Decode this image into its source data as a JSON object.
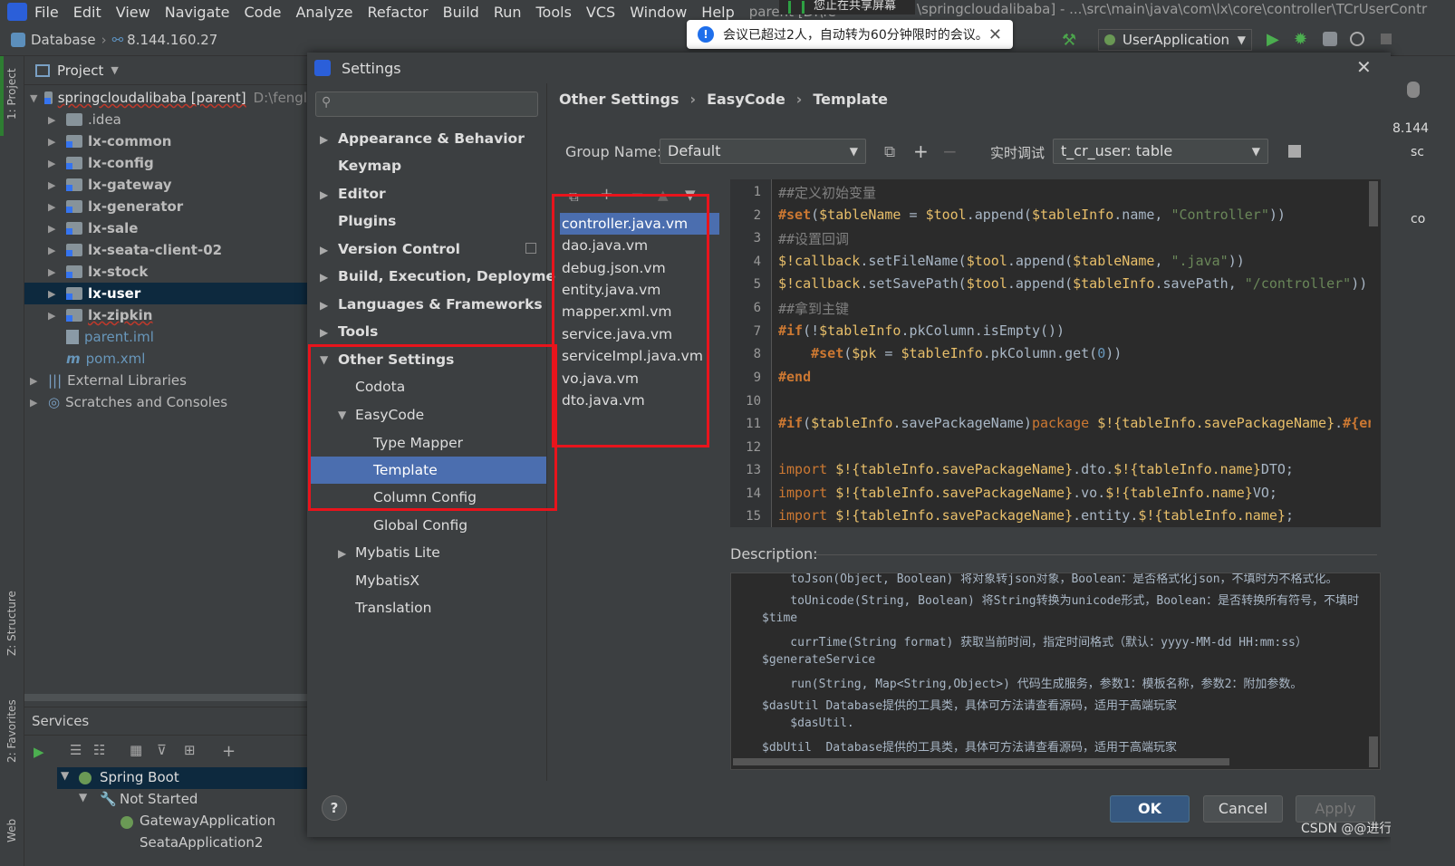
{
  "menu": {
    "items": [
      "File",
      "Edit",
      "View",
      "Navigate",
      "Code",
      "Analyze",
      "Refactor",
      "Build",
      "Run",
      "Tools",
      "VCS",
      "Window",
      "Help"
    ],
    "window_title_left": "parent [D:\\fe",
    "window_title_right": "\\springcloudalibaba] - ...\\src\\main\\java\\com\\lx\\core\\controller\\TCrUserContr"
  },
  "share_banner": "您止在共享屏幕",
  "navbar": {
    "database_label": "Database",
    "ip": "8.144.160.27"
  },
  "toast": {
    "message": "会议已超过2人，自动转为60分钟限时的会议。"
  },
  "run_config": "UserApplication",
  "project_panel": {
    "title": "Project",
    "tree": [
      {
        "label": "springcloudalibaba [parent]",
        "suffix": "D:\\fengl",
        "depth": 0,
        "type": "module",
        "expanded": true
      },
      {
        "label": ".idea",
        "depth": 1,
        "type": "folder",
        "expanded": false
      },
      {
        "label": "lx-common",
        "depth": 1,
        "type": "module",
        "expanded": false
      },
      {
        "label": "lx-config",
        "depth": 1,
        "type": "module",
        "expanded": false
      },
      {
        "label": "lx-gateway",
        "depth": 1,
        "type": "module",
        "expanded": false
      },
      {
        "label": "lx-generator",
        "depth": 1,
        "type": "module",
        "expanded": false
      },
      {
        "label": "lx-sale",
        "depth": 1,
        "type": "module",
        "expanded": false
      },
      {
        "label": "lx-seata-client-02",
        "depth": 1,
        "type": "module",
        "expanded": false
      },
      {
        "label": "lx-stock",
        "depth": 1,
        "type": "module",
        "expanded": false
      },
      {
        "label": "lx-user",
        "depth": 1,
        "type": "module",
        "expanded": false,
        "selected": true
      },
      {
        "label": "lx-zipkin",
        "depth": 1,
        "type": "module",
        "expanded": false
      },
      {
        "label": "parent.iml",
        "depth": 1,
        "type": "file"
      },
      {
        "label": "pom.xml",
        "depth": 1,
        "type": "file"
      },
      {
        "label": "External Libraries",
        "depth": 0,
        "type": "lib",
        "expanded": false
      },
      {
        "label": "Scratches and Consoles",
        "depth": 0,
        "type": "lib",
        "expanded": false
      }
    ]
  },
  "left_strip": {
    "project_tab": "1: Project",
    "structure_tab": "Z: Structure",
    "favorites_tab": "2: Favorites",
    "web_tab": "Web"
  },
  "services": {
    "title": "Services",
    "items": [
      {
        "label": "Spring Boot",
        "depth": 0
      },
      {
        "label": "Not Started",
        "depth": 1
      },
      {
        "label": "GatewayApplication",
        "depth": 2
      },
      {
        "label": "SeataApplication2",
        "depth": 2
      }
    ]
  },
  "dialog": {
    "title": "Settings",
    "breadcrumb": [
      "Other Settings",
      "EasyCode",
      "Template"
    ],
    "nav": [
      {
        "label": "Appearance & Behavior",
        "bold": true,
        "arrow": "right"
      },
      {
        "label": "Keymap",
        "bold": true
      },
      {
        "label": "Editor",
        "bold": true,
        "arrow": "right"
      },
      {
        "label": "Plugins",
        "bold": true
      },
      {
        "label": "Version Control",
        "bold": true,
        "arrow": "right"
      },
      {
        "label": "Build, Execution, Deployment",
        "bold": true,
        "arrow": "right"
      },
      {
        "label": "Languages & Frameworks",
        "bold": true,
        "arrow": "right"
      },
      {
        "label": "Tools",
        "bold": true,
        "arrow": "right"
      },
      {
        "label": "Other Settings",
        "bold": true,
        "arrow": "down"
      },
      {
        "label": "Codota",
        "bold": false
      },
      {
        "label": "EasyCode",
        "bold": false,
        "arrow": "down"
      },
      {
        "label": "Type Mapper",
        "bold": false
      },
      {
        "label": "Template",
        "bold": false,
        "selected": true
      },
      {
        "label": "Column Config",
        "bold": false
      },
      {
        "label": "Global Config",
        "bold": false
      },
      {
        "label": "Mybatis Lite",
        "bold": false,
        "arrow": "right"
      },
      {
        "label": "MybatisX",
        "bold": false
      },
      {
        "label": "Translation",
        "bold": false
      }
    ],
    "group_name_label": "Group Name:",
    "group_name_value": "Default",
    "debug_label": "实时调试",
    "debug_value": "t_cr_user: table",
    "files": [
      "controller.java.vm",
      "dao.java.vm",
      "debug.json.vm",
      "entity.java.vm",
      "mapper.xml.vm",
      "service.java.vm",
      "serviceImpl.java.vm",
      "vo.java.vm",
      "dto.java.vm"
    ],
    "selected_file": "controller.java.vm",
    "line_numbers": [
      "1",
      "2",
      "3",
      "4",
      "5",
      "6",
      "7",
      "8",
      "9",
      "10",
      "11",
      "12",
      "13",
      "14",
      "15"
    ],
    "description_label": "Description:",
    "description_lines": [
      "    toJson(Object, Boolean) 将对象转json对象，Boolean：是否格式化json，不填时为不格式化。",
      "    toUnicode(String, Boolean) 将String转换为unicode形式，Boolean：是否转换所有符号，不填时",
      "$time",
      "    currTime(String format) 获取当前时间，指定时间格式（默认：yyyy-MM-dd HH:mm:ss）",
      "$generateService",
      "    run(String, Map<String,Object>) 代码生成服务，参数1：模板名称，参数2：附加参数。",
      "$dasUtil Database提供的工具类，具体可方法请查看源码，适用于高端玩家",
      "    $dasUtil.",
      "$dbUtil  Database提供的工具类，具体可方法请查看源码，适用于高端玩家"
    ],
    "buttons": {
      "ok": "OK",
      "cancel": "Cancel",
      "apply": "Apply",
      "help": "?"
    }
  },
  "code": {
    "l1": "##定义初始变量",
    "l2a": "#set",
    "l2b": "(",
    "l2c": "$tableName",
    "l2d": " = ",
    "l2e": "$tool",
    "l2f": ".append(",
    "l2g": "$tableInfo",
    "l2h": ".name, ",
    "l2i": "\"Controller\"",
    "l2j": "))",
    "l3": "##设置回调",
    "l4a": "$!callback",
    "l4b": ".setFileName(",
    "l4c": "$tool",
    "l4d": ".append(",
    "l4e": "$tableName",
    "l4f": ", ",
    "l4g": "\".java\"",
    "l4h": "))",
    "l5a": "$!callback",
    "l5b": ".setSavePath(",
    "l5c": "$tool",
    "l5d": ".append(",
    "l5e": "$tableInfo",
    "l5f": ".savePath, ",
    "l5g": "\"/controller\"",
    "l5h": "))",
    "l6": "##拿到主键",
    "l7a": "#if",
    "l7b": "(!",
    "l7c": "$tableInfo",
    "l7d": ".pkColumn.isEmpty())",
    "l8a": "    #set",
    "l8b": "(",
    "l8c": "$pk",
    "l8d": " = ",
    "l8e": "$tableInfo",
    "l8f": ".pkColumn.get(",
    "l8g": "0",
    "l8h": "))",
    "l9": "#end",
    "l11a": "#if",
    "l11b": "(",
    "l11c": "$tableInfo",
    "l11d": ".savePackageName)",
    "l11e": "package ",
    "l11f": "$!{tableInfo.savePackageName}",
    "l11g": ".",
    "l11h": "#{end}",
    "l11i": "c",
    "l13a": "import ",
    "l13b": "$!{tableInfo.savePackageName}",
    "l13c": ".dto.",
    "l13d": "$!{tableInfo.name}",
    "l13e": "DTO;",
    "l14a": "import ",
    "l14b": "$!{tableInfo.savePackageName}",
    "l14c": ".vo.",
    "l14d": "$!{tableInfo.name}",
    "l14e": "VO;",
    "l15a": "import ",
    "l15b": "$!{tableInfo.savePackageName}",
    "l15c": ".entity.",
    "l15d": "$!{tableInfo.name}",
    "l15e": ";"
  },
  "right_strip": {
    "ip_fragment": "8.144",
    "text1": "sc",
    "text2": "co"
  },
  "watermark": "CSDN @@进行中",
  "colors": {
    "highlight_box": "#e8141c",
    "selection": "#4b6eaf",
    "primary_button": "#365880"
  }
}
